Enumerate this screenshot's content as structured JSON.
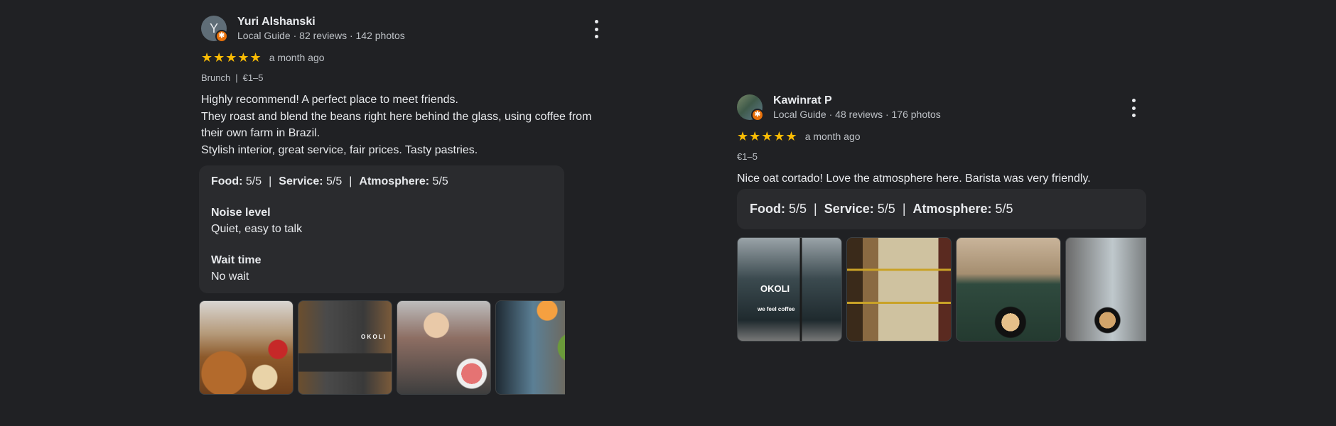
{
  "reviews": [
    {
      "avatar_letter": "Y",
      "name": "Yuri Alshanski",
      "meta": "Local Guide · 82 reviews · 142 photos",
      "stars": "★★★★★",
      "rating": 5,
      "time": "a month ago",
      "attributes": [
        "Brunch",
        "€1–5"
      ],
      "attr_separator": "|",
      "text_lines": [
        "Highly recommend! A perfect place to meet friends.",
        "They roast and blend the beans right here behind the glass, using coffee from",
        "their own farm in Brazil.",
        "Stylish interior, great service, fair prices. Tasty pastries."
      ],
      "scores": {
        "food_label": "Food:",
        "food": "5/5",
        "service_label": "Service:",
        "service": "5/5",
        "atmosphere_label": "Atmosphere:",
        "atmosphere": "5/5",
        "separator": "|"
      },
      "noise_title": "Noise level",
      "noise_value": "Quiet, easy to talk",
      "wait_title": "Wait time",
      "wait_value": "No wait",
      "photo_count": 4
    },
    {
      "name": "Kawinrat P",
      "meta": "Local Guide · 48 reviews · 176 photos",
      "stars": "★★★★★",
      "rating": 5,
      "time": "a month ago",
      "attributes": [
        "€1–5"
      ],
      "text_lines": [
        "Nice oat cortado! Love the atmosphere here. Barista was very friendly."
      ],
      "scores": {
        "food_label": "Food:",
        "food": "5/5",
        "service_label": "Service:",
        "service": "5/5",
        "atmosphere_label": "Atmosphere:",
        "atmosphere": "5/5",
        "separator": "|"
      },
      "photo_count": 4,
      "photo_text": [
        "OKOLI",
        "we feel coffee"
      ]
    }
  ],
  "colors": {
    "background": "#202124",
    "card": "#2a2b2e",
    "star": "#fbbc04",
    "guide_badge": "#e8710a",
    "text_primary": "#e8eaed",
    "text_secondary": "#bdc1c6"
  },
  "icons": {
    "more": "more-vert-icon",
    "star": "star-icon",
    "badge": "local-guide-badge-icon"
  }
}
